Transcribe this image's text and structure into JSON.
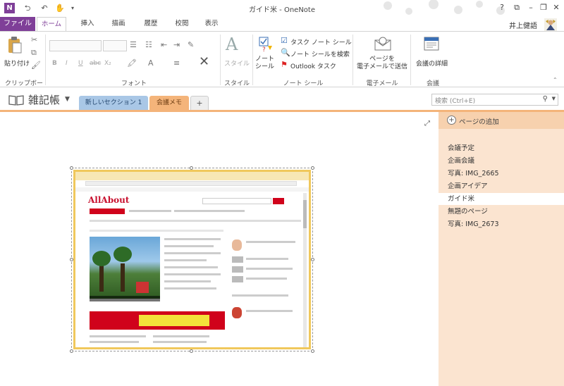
{
  "window": {
    "title": "ガイド米 - OneNote",
    "app_icon": "N"
  },
  "quick_access": {
    "back_icon": "back-icon",
    "undo_icon": "undo-icon",
    "touch_icon": "touch-icon"
  },
  "window_controls": {
    "help": "?",
    "minimize": "–",
    "restore": "❐",
    "close": "✕"
  },
  "ribbon_tabs": {
    "file": "ファイル",
    "items": [
      "ホーム",
      "挿入",
      "描画",
      "履歴",
      "校閲",
      "表示"
    ],
    "active_index": 0
  },
  "user": {
    "name": "井上健語"
  },
  "ribbon": {
    "clipboard": {
      "paste": "貼り付け",
      "group": "クリップボード"
    },
    "font": {
      "bold": "B",
      "italic": "I",
      "underline": "U",
      "strike": "abc",
      "subscript": "X₂",
      "group": "フォント"
    },
    "style": {
      "label": "スタイル",
      "group": "スタイル"
    },
    "note_seal": {
      "note_seal": "ノート\nシール",
      "task_note_seal": "タスク ノート シール",
      "search_note_seal": "ノート シールを検索",
      "outlook_task": "Outlook タスク",
      "group": "ノート シール"
    },
    "email": {
      "send": "ページを\n電子メールで送信",
      "group": "電子メール"
    },
    "meeting": {
      "details": "会議の詳細",
      "group": "会議"
    }
  },
  "notebook": {
    "name": "雑記帳",
    "sections": [
      {
        "label": "新しいセクション 1",
        "color": "#a9c7e6"
      },
      {
        "label": "会議メモ",
        "color": "#f4b47a"
      }
    ],
    "add_section": "+"
  },
  "search": {
    "placeholder": "検索 (Ctrl+E)"
  },
  "pages_pane": {
    "add_page": "ページの追加",
    "pages": [
      "会議予定",
      "企画会議",
      "写真: IMG_2665",
      "企画アイデア",
      "ガイド米",
      "無題のページ",
      "写真: IMG_2673"
    ],
    "selected_index": 4
  },
  "embedded": {
    "logo": "AllAbout"
  },
  "colors": {
    "accent": "#7f3f98",
    "section_orange": "#f4b47a",
    "pane_bg": "#fbe4d0"
  }
}
